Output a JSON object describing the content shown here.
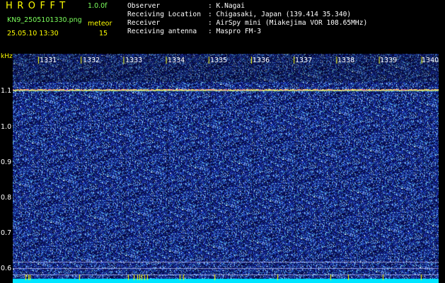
{
  "header": {
    "app_title": "HROFFT",
    "version": "1.0.0f",
    "filename": "KN9_2505101330.png",
    "mode_label": "meteor",
    "datetime": "25.05.10 13:30",
    "count": "15",
    "meta_rows": [
      {
        "label": "Observer",
        "value": ": K.Nagai"
      },
      {
        "label": "Receiving Location",
        "value": ": Chigasaki, Japan (139.414 35.340)"
      },
      {
        "label": "Receiver",
        "value": ": AirSpy mini (Miakejima VOR 108.65MHz)"
      },
      {
        "label": "Receiving antenna",
        "value": ": Maspro FM-3"
      }
    ]
  },
  "spectrogram": {
    "y_unit": "kHz",
    "y_ticks": [
      "1.1",
      "1.0",
      "0.9",
      "0.8",
      "0.7",
      "0.6"
    ],
    "x_ticks": [
      "1331",
      "1332",
      "1333",
      "1334",
      "1335",
      "1336",
      "1337",
      "1338",
      "1339",
      "1340"
    ],
    "colors": {
      "background": "#000000",
      "noise_low": "#1a1f8c",
      "noise_high": "#9ad6ff",
      "carrier": "#ffe36a",
      "cursor": "#00ffff"
    }
  }
}
